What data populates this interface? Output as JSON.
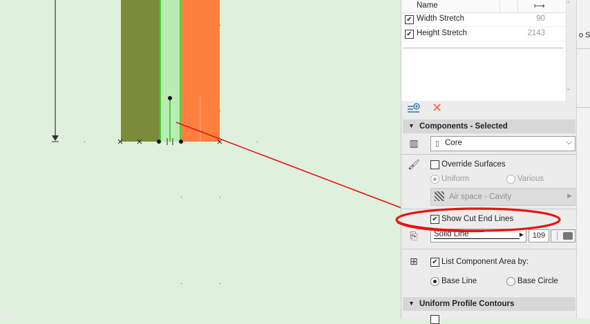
{
  "list": {
    "header_name": "Name",
    "header_stretch_icon": "stretch-width-icon",
    "rows": [
      {
        "label": "Width Stretch",
        "value": "90",
        "checked": true
      },
      {
        "label": "Height Stretch",
        "value": "2143",
        "checked": true
      }
    ]
  },
  "tools": {
    "add_icon": "add-component-icon",
    "delete_icon": "delete-icon"
  },
  "components": {
    "title": "Components - Selected",
    "selected": "Core"
  },
  "surfaces": {
    "override_label": "Override Surfaces",
    "override_checked": false,
    "uniform_label": "Uniform",
    "various_label": "Various",
    "surface_value": "Air space - Cavity"
  },
  "cut_end": {
    "label": "Show Cut End Lines",
    "checked": true,
    "line_type": "Solid Line",
    "pen_number": "109"
  },
  "area": {
    "label": "List Component Area by:",
    "checked": true,
    "base_line_label": "Base Line",
    "base_circle_label": "Base Circle",
    "selected": "Base Line"
  },
  "contours": {
    "title": "Uniform Profile Contours"
  },
  "right_strip": {
    "partial_text": "o Se"
  },
  "colors": {
    "canvas_bg": "#dff1dd",
    "olive_component": "#7b8b3a",
    "core_green": "#b9ecb1",
    "orange_component": "#ff7f3f",
    "annotation_red": "#e8120f"
  }
}
